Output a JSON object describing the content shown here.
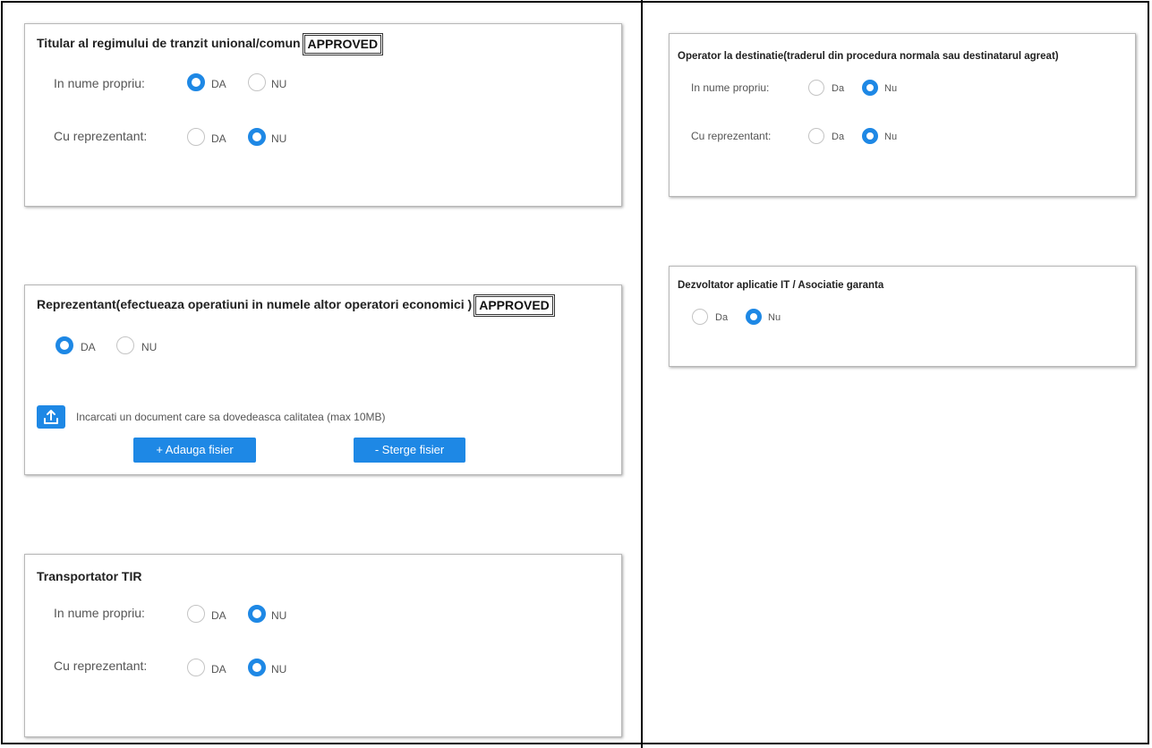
{
  "titular": {
    "title": "Titular al regimului de tranzit unional/comun",
    "badge": "APPROVED",
    "rows": [
      {
        "label": "In nume propriu:",
        "yes": "DA",
        "no": "NU",
        "selected": "yes"
      },
      {
        "label": "Cu reprezentant:",
        "yes": "DA",
        "no": "NU",
        "selected": "no"
      }
    ]
  },
  "reprezentant": {
    "title": "Reprezentant(efectueaza operatiuni in numele altor operatori economici )",
    "badge": "APPROVED",
    "yes": "DA",
    "no": "NU",
    "selected": "yes",
    "upload_text": "Incarcati un document care sa dovedeasca calitatea (max 10MB)",
    "add_file": "+ Adauga fisier",
    "delete_file": "- Sterge fisier"
  },
  "transportator": {
    "title": "Transportator TIR",
    "rows": [
      {
        "label": "In nume propriu:",
        "yes": "DA",
        "no": "NU",
        "selected": "no"
      },
      {
        "label": "Cu reprezentant:",
        "yes": "DA",
        "no": "NU",
        "selected": "no"
      }
    ]
  },
  "operator": {
    "title": "Operator la destinatie(traderul din procedura normala sau destinatarul agreat)",
    "rows": [
      {
        "label": "In nume propriu:",
        "yes": "Da",
        "no": "Nu",
        "selected": "no"
      },
      {
        "label": "Cu reprezentant:",
        "yes": "Da",
        "no": "Nu",
        "selected": "no"
      }
    ]
  },
  "dezvoltator": {
    "title": "Dezvoltator aplicatie IT / Asociatie garanta",
    "yes": "Da",
    "no": "Nu",
    "selected": "no"
  },
  "colors": {
    "accent": "#1e88e5",
    "border": "#b8b8b8"
  },
  "icons": {
    "upload": "upload-icon"
  }
}
